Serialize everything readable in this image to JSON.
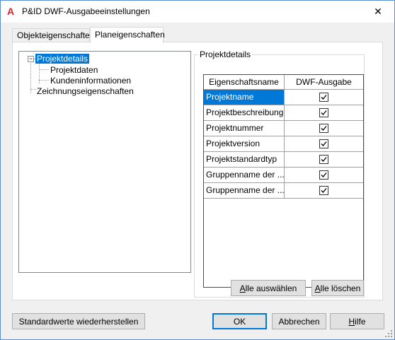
{
  "window": {
    "title": "P&ID DWF-Ausgabeeinstellungen",
    "close_glyph": "✕",
    "app_icon_glyph": "A",
    "accent_color": "#0078d7",
    "icon_color": "#d9242b"
  },
  "tabs": [
    {
      "label": "Objekteigenschaften",
      "active": false
    },
    {
      "label": "Planeigenschaften",
      "active": true
    }
  ],
  "tree": {
    "nodes": [
      {
        "label": "Projektdetails",
        "selected": true,
        "expander": "−"
      },
      {
        "label": "Projektdaten"
      },
      {
        "label": "Kundeninformationen"
      },
      {
        "label": "Zeichnungseigenschaften"
      }
    ]
  },
  "details": {
    "group_label": "Projektdetails",
    "columns": [
      "Eigenschaftsname",
      "DWF-Ausgabe"
    ],
    "rows": [
      {
        "name": "Projektname",
        "checked": true,
        "selected": true
      },
      {
        "name": "Projektbeschreibung",
        "checked": true
      },
      {
        "name": "Projektnummer",
        "checked": true
      },
      {
        "name": "Projektversion",
        "checked": true
      },
      {
        "name": "Projektstandardtyp",
        "checked": true
      },
      {
        "name": "Gruppenname der ...",
        "checked": true
      },
      {
        "name": "Gruppenname der ...",
        "checked": true
      }
    ],
    "select_all": {
      "mnemonic": "A",
      "rest": "lle auswählen"
    },
    "clear_all": {
      "mnemonic": "A",
      "rest": "lle löschen"
    }
  },
  "footer": {
    "restore_defaults": "Standardwerte wiederherstellen",
    "ok": "OK",
    "cancel": "Abbrechen",
    "help": {
      "mnemonic": "H",
      "rest": "ilfe"
    }
  }
}
